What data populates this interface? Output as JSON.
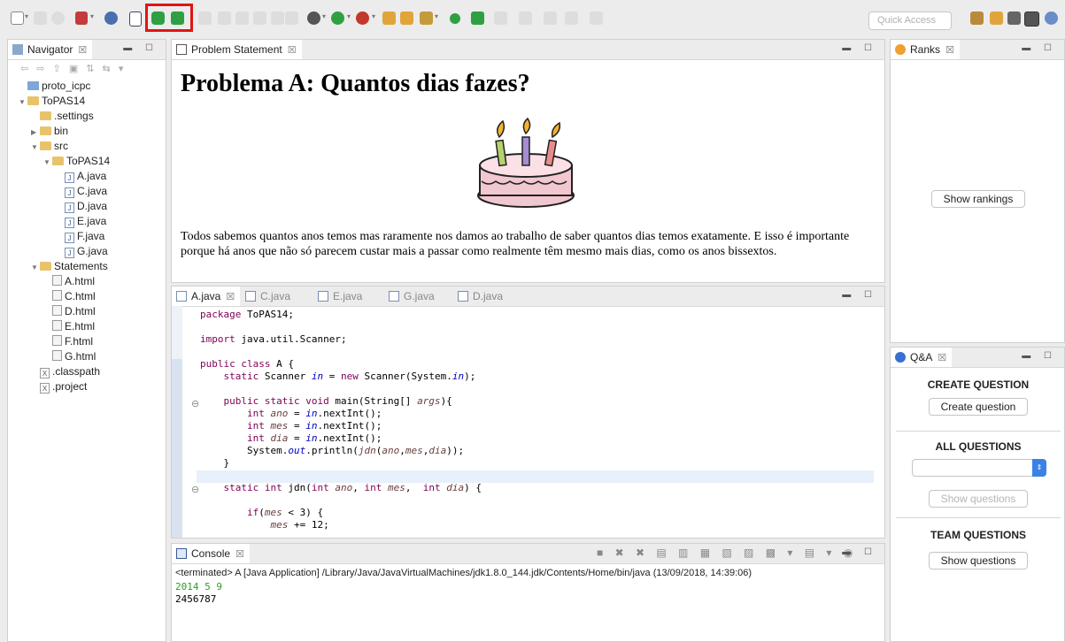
{
  "toolbar": {
    "quick_access_placeholder": "Quick Access"
  },
  "navigator": {
    "tab_label": "Navigator",
    "tree": [
      {
        "label": "proto_icpc",
        "icon": "project-icon",
        "depth": 0,
        "twisty": ""
      },
      {
        "label": "ToPAS14",
        "icon": "project-folder-icon",
        "depth": 0,
        "twisty": "▼"
      },
      {
        "label": ".settings",
        "icon": "folder-icon",
        "depth": 1,
        "twisty": ""
      },
      {
        "label": "bin",
        "icon": "folder-icon",
        "depth": 1,
        "twisty": "▶"
      },
      {
        "label": "src",
        "icon": "folder-icon",
        "depth": 1,
        "twisty": "▼"
      },
      {
        "label": "ToPAS14",
        "icon": "folder-icon",
        "depth": 2,
        "twisty": "▼"
      },
      {
        "label": "A.java",
        "icon": "java-file-icon",
        "depth": 3,
        "twisty": ""
      },
      {
        "label": "C.java",
        "icon": "java-file-icon",
        "depth": 3,
        "twisty": ""
      },
      {
        "label": "D.java",
        "icon": "java-file-icon",
        "depth": 3,
        "twisty": ""
      },
      {
        "label": "E.java",
        "icon": "java-file-icon",
        "depth": 3,
        "twisty": ""
      },
      {
        "label": "F.java",
        "icon": "java-file-icon",
        "depth": 3,
        "twisty": ""
      },
      {
        "label": "G.java",
        "icon": "java-file-icon",
        "depth": 3,
        "twisty": ""
      },
      {
        "label": "Statements",
        "icon": "folder-icon",
        "depth": 1,
        "twisty": "▼"
      },
      {
        "label": "A.html",
        "icon": "html-file-icon",
        "depth": 2,
        "twisty": ""
      },
      {
        "label": "C.html",
        "icon": "html-file-icon",
        "depth": 2,
        "twisty": ""
      },
      {
        "label": "D.html",
        "icon": "html-file-icon",
        "depth": 2,
        "twisty": ""
      },
      {
        "label": "E.html",
        "icon": "html-file-icon",
        "depth": 2,
        "twisty": ""
      },
      {
        "label": "F.html",
        "icon": "html-file-icon",
        "depth": 2,
        "twisty": ""
      },
      {
        "label": "G.html",
        "icon": "html-file-icon",
        "depth": 2,
        "twisty": ""
      },
      {
        "label": ".classpath",
        "icon": "xml-file-icon",
        "depth": 1,
        "twisty": ""
      },
      {
        "label": ".project",
        "icon": "xml-file-icon",
        "depth": 1,
        "twisty": ""
      }
    ]
  },
  "statement": {
    "tab_label": "Problem Statement",
    "title": "Problema A: Quantos dias fazes?",
    "body": "Todos sabemos quantos anos temos mas raramente nos damos ao trabalho de saber quantos dias temos exatamente. E isso é importante porque há anos que não só parecem custar mais a passar como realmente têm mesmo mais dias, como os anos bissextos."
  },
  "editor": {
    "tabs": [
      "A.java",
      "C.java",
      "E.java",
      "G.java",
      "D.java"
    ],
    "active_tab": "A.java"
  },
  "console": {
    "tab_label": "Console",
    "status": "<terminated> A [Java Application] /Library/Java/JavaVirtualMachines/jdk1.8.0_144.jdk/Contents/Home/bin/java (13/09/2018, 14:39:06)",
    "input_line": "2014 5 9",
    "output_line": "2456787"
  },
  "ranks": {
    "tab_label": "Ranks",
    "button": "Show rankings"
  },
  "qa": {
    "tab_label": "Q&A",
    "create_heading": "CREATE QUESTION",
    "create_button": "Create question",
    "all_heading": "ALL QUESTIONS",
    "all_select_value": "",
    "all_button": "Show questions",
    "team_heading": "TEAM QUESTIONS",
    "team_button": "Show questions"
  },
  "colors": {
    "highlight": "#e01515",
    "keyword": "#7f0055",
    "field": "#0000c0",
    "console_input": "#2a9d2a"
  }
}
